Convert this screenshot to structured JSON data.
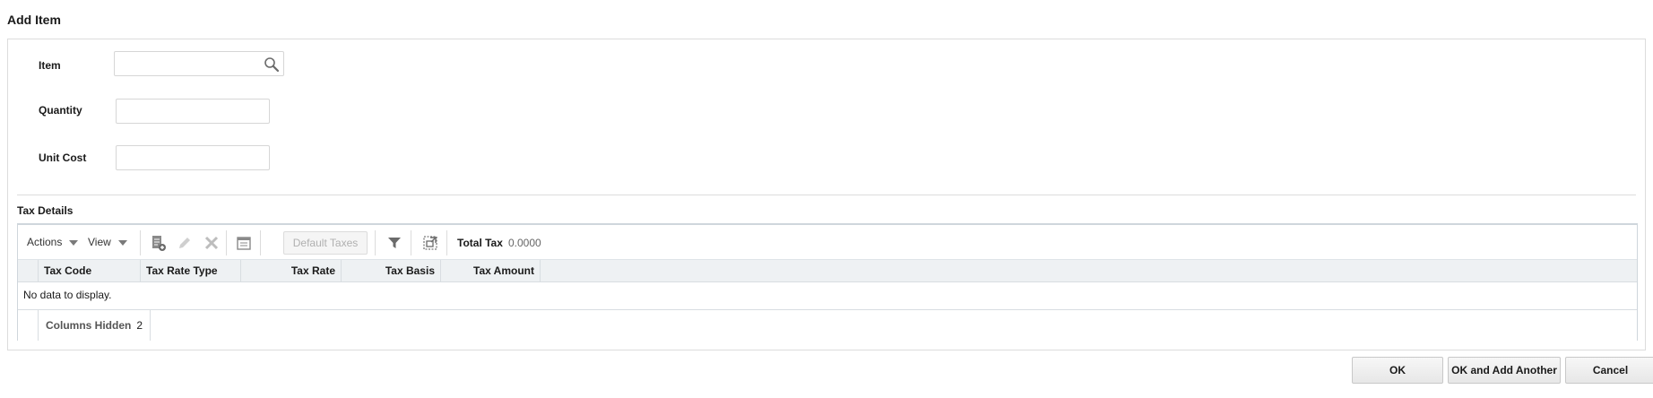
{
  "dialog": {
    "title": "Add Item"
  },
  "form": {
    "item": {
      "label": "Item",
      "value": ""
    },
    "quantity": {
      "label": "Quantity",
      "value": ""
    },
    "unit_cost": {
      "label": "Unit Cost",
      "value": ""
    }
  },
  "tax_details": {
    "title": "Tax Details",
    "toolbar": {
      "actions_label": "Actions",
      "view_label": "View",
      "default_taxes_label": "Default Taxes",
      "total_tax_label": "Total Tax",
      "total_tax_value": "0.0000",
      "icons": [
        "add-row-icon",
        "edit-icon",
        "delete-icon",
        "calendar-icon",
        "filter-icon",
        "detach-icon"
      ]
    },
    "columns": [
      "Tax Code",
      "Tax Rate Type",
      "Tax Rate",
      "Tax Basis",
      "Tax Amount"
    ],
    "empty_message": "No data to display.",
    "footer": {
      "columns_hidden_label": "Columns Hidden",
      "columns_hidden_value": "2"
    }
  },
  "buttons": {
    "ok": "OK",
    "ok_add_another": "OK and Add Another",
    "cancel": "Cancel"
  }
}
